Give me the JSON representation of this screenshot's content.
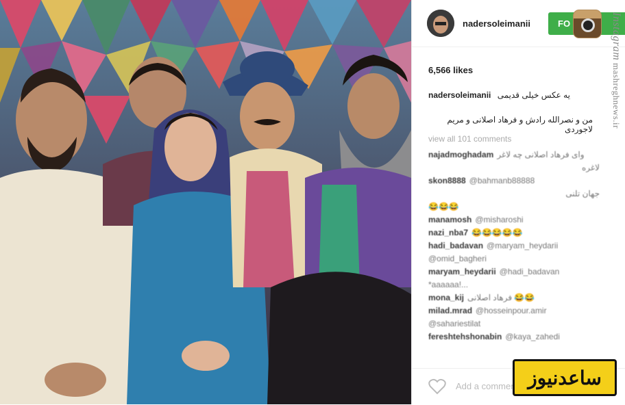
{
  "post": {
    "username": "nadersoleimanii",
    "follow_label": "FO",
    "likes": "6,566 likes",
    "caption_username": "nadersoleimanii",
    "caption_line1": "یه عکس خیلی قدیمی",
    "caption_line2": "من و نصرالله رادش و فرهاد اصلانی و مریم لاجوردی",
    "view_all": "view all 101 comments",
    "add_comment_placeholder": "Add a comment..."
  },
  "comments": [
    {
      "user": "najadmoghadam",
      "text": "وای فرهاد اصلانی چه لاغر"
    },
    {
      "user": "",
      "text": "لاغره"
    },
    {
      "user": "skon8888",
      "text": "@bahmanb88888"
    },
    {
      "user": "",
      "text": "جهان تلنی"
    },
    {
      "user": "",
      "text": "😂😂😂"
    },
    {
      "user": "manamosh",
      "text": "@misharoshi"
    },
    {
      "user": "nazi_nba7",
      "text": "😂😂😂😂😂"
    },
    {
      "user": "hadi_badavan",
      "text": "@maryam_heydarii"
    },
    {
      "user": "",
      "text": "@omid_bagheri"
    },
    {
      "user": "maryam_heydarii",
      "text": "@hadi_badavan"
    },
    {
      "user": "",
      "text": "*aaaaaa!..."
    },
    {
      "user": "mona_kij",
      "text": "فرهاد اصلانی 😂😂"
    },
    {
      "user": "milad.mrad",
      "text": "@hosseinpour.amir"
    },
    {
      "user": "",
      "text": "@sahariestilat"
    },
    {
      "user": "fereshtehshonabin",
      "text": "@kaya_zahedi"
    }
  ],
  "watermark": {
    "brand_script": "Instagram",
    "site": "mashreghnews.ir"
  },
  "badge_text": "ساعدنیوز",
  "colors": {
    "follow_bg": "#3fae49",
    "badge_bg": "#f4cf19"
  },
  "icons": [
    "instagram-logo-icon",
    "heart-icon"
  ]
}
